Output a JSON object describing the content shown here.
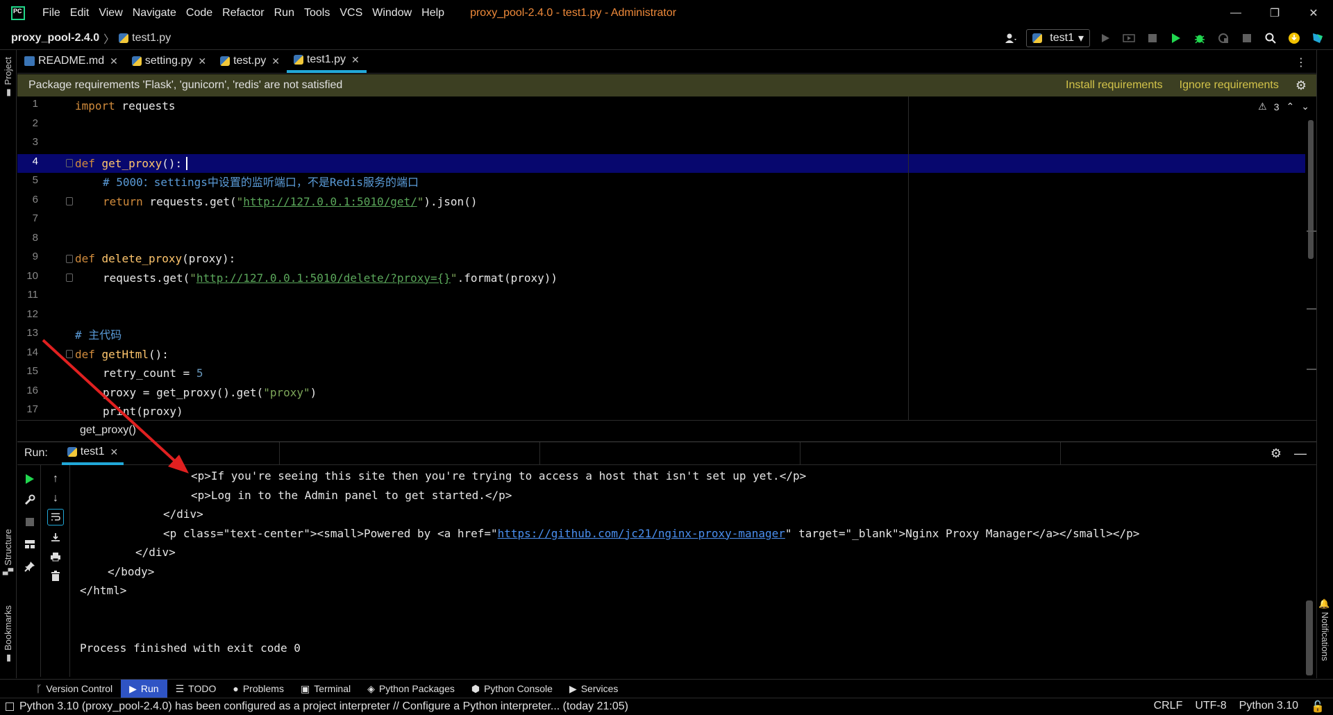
{
  "menu": [
    "File",
    "Edit",
    "View",
    "Navigate",
    "Code",
    "Refactor",
    "Run",
    "Tools",
    "VCS",
    "Window",
    "Help"
  ],
  "window_title": "proxy_pool-2.4.0 - test1.py - Administrator",
  "window_controls": {
    "minimize": "—",
    "restore": "❐",
    "close": "✕"
  },
  "breadcrumb": {
    "project": "proxy_pool-2.4.0",
    "sep": "〉",
    "file": "test1.py"
  },
  "run_config": {
    "label": "test1",
    "arrow": "▾"
  },
  "tabs": [
    {
      "label": "README.md",
      "active": false
    },
    {
      "label": "setting.py",
      "active": false
    },
    {
      "label": "test.py",
      "active": false
    },
    {
      "label": "test1.py",
      "active": true
    }
  ],
  "banner": {
    "message": "Package requirements 'Flask', 'gunicorn', 'redis' are not satisfied",
    "install": "Install requirements",
    "ignore": "Ignore requirements"
  },
  "inspection": {
    "warning_count": "3"
  },
  "editor": {
    "line_numbers": [
      "1",
      "2",
      "3",
      "4",
      "5",
      "6",
      "7",
      "8",
      "9",
      "10",
      "11",
      "12",
      "13",
      "14",
      "15",
      "16",
      "17"
    ],
    "current_line": "4",
    "code": {
      "l1_kw": "import",
      "l1_rest": " requests",
      "l4_kw": "def",
      "l4_fn": " get_proxy",
      "l4_rest": "():",
      "l5_comment": "# 5000：settings中设置的监听端口，不是Redis服务的端口",
      "l6_kw": "return",
      "l6_a": " requests.get(",
      "l6_q1": "\"",
      "l6_url": "http://127.0.0.1:5010/get/",
      "l6_q2": "\"",
      "l6_b": ").json()",
      "l9_kw": "def",
      "l9_fn": " delete_proxy",
      "l9_rest": "(proxy):",
      "l10_a": "requests.get(",
      "l10_q1": "\"",
      "l10_url": "http://127.0.0.1:5010/delete/?proxy={}",
      "l10_q2": "\"",
      "l10_b": ".format(proxy))",
      "l13_comment": "# 主代码",
      "l14_kw": "def",
      "l14_fn": " getHtml",
      "l14_rest": "():",
      "l15_a": "retry_count = ",
      "l15_num": "5",
      "l16_a": "proxy = get_proxy().get(",
      "l16_st": "\"proxy\"",
      "l16_b": ")",
      "l17_a": "print(proxy)"
    },
    "crumb": "get_proxy()"
  },
  "run_panel": {
    "label": "Run:",
    "tab": "test1",
    "console": [
      "<p>If you're seeing this site then you're trying to access a host that isn't set up yet.</p>",
      "<p>Log in to the Admin panel to get started.</p>",
      "</div>",
      "<p class=\"text-center\"><small>Powered by <a href=\"",
      "https://github.com/jc21/nginx-proxy-manager",
      "\" target=\"_blank\">Nginx Proxy Manager</a></small></p>",
      "</div>",
      "</body>",
      "</html>",
      "Process finished with exit code 0"
    ]
  },
  "toolwindows": [
    "Version Control",
    "Run",
    "TODO",
    "Problems",
    "Terminal",
    "Python Packages",
    "Python Console",
    "Services"
  ],
  "left_strip": {
    "project": "Project",
    "structure": "Structure",
    "bookmarks": "Bookmarks"
  },
  "right_strip": {
    "notifications": "Notifications"
  },
  "status": {
    "message": "Python 3.10 (proxy_pool-2.4.0) has been configured as a project interpreter // Configure a Python interpreter... (today 21:05)",
    "line_sep": "CRLF",
    "encoding": "UTF-8",
    "interpreter": "Python 3.10"
  },
  "colors": {
    "accent": "#21a8d8",
    "banner_bg": "#3c3f22",
    "current_line": "#07076e",
    "annotation": "#e02020"
  }
}
